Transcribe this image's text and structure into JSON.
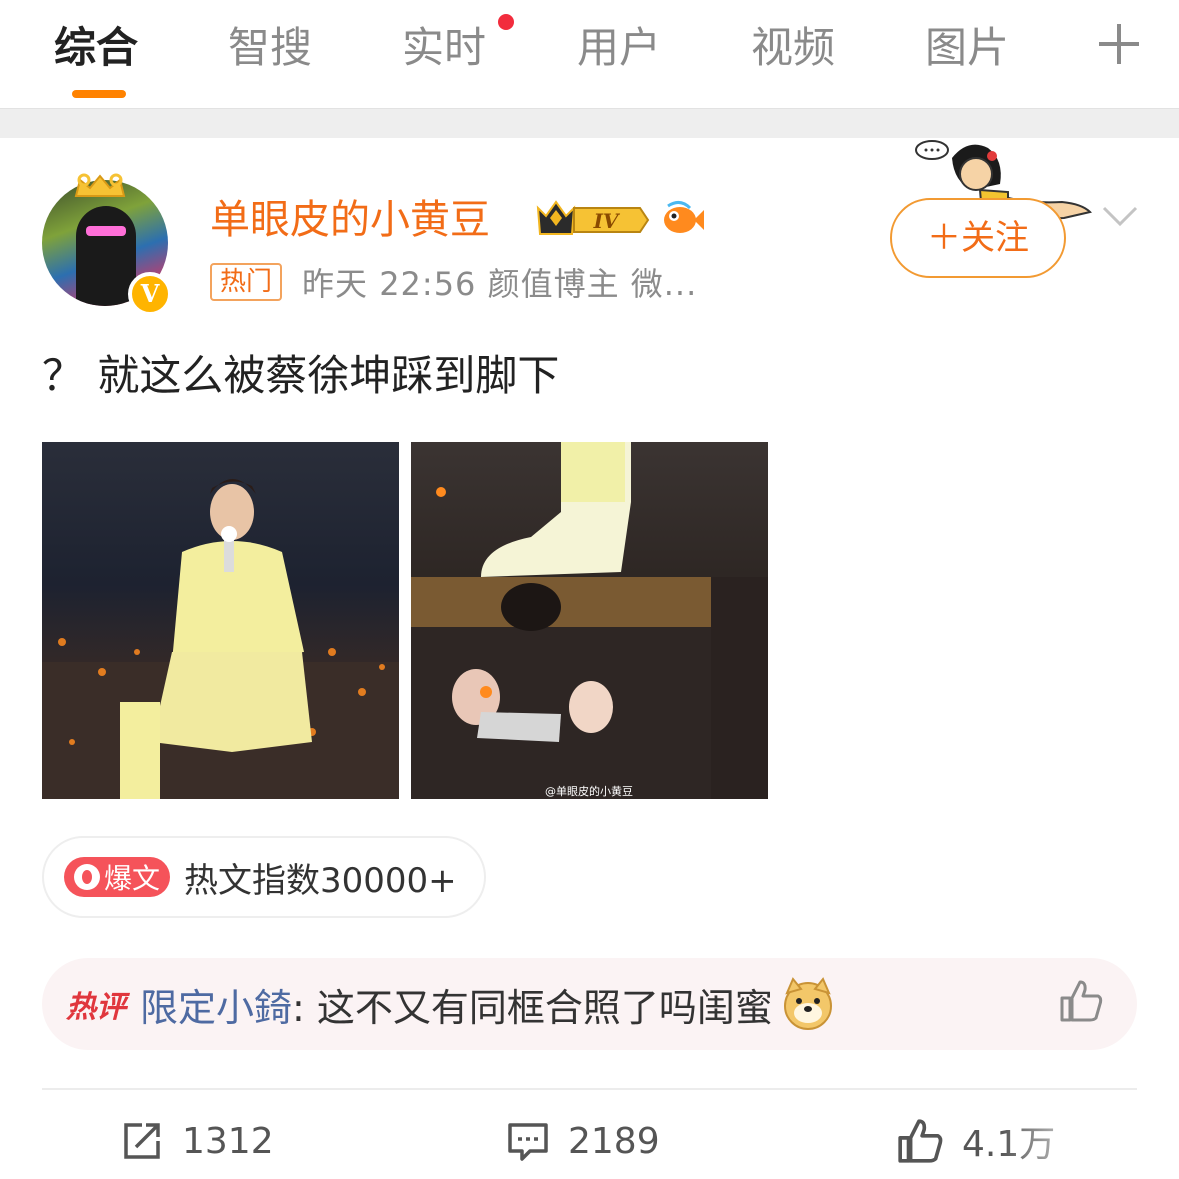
{
  "tabs": [
    {
      "label": "综合"
    },
    {
      "label": "智搜"
    },
    {
      "label": "实时"
    },
    {
      "label": "用户"
    },
    {
      "label": "视频"
    },
    {
      "label": "图片"
    }
  ],
  "colors": {
    "accent": "#ff8200",
    "username": "#f26c17",
    "badge_red": "#f22c3d",
    "link_blue": "#4e6aa2"
  },
  "post": {
    "username": "单眼皮的小黄豆",
    "level_badge": "IV",
    "verified_badge": "V",
    "hot_tag": "热门",
    "meta": "昨天 22:56  颜值博主 微...",
    "follow_label": "＋关注",
    "text": "？ 就这么被蔡徐坤踩到脚下",
    "image_watermark": "@单眼皮的小黄豆",
    "hot_badge": "爆文",
    "hot_index": "热文指数30000+"
  },
  "hot_comment": {
    "label": "热评",
    "user": "限定小錡",
    "text": ": 这不又有同框合照了吗闺蜜",
    "emoji": "doge-icon"
  },
  "actions": {
    "repost_count": "1312",
    "comment_count": "2189",
    "like_count": "4.1万"
  }
}
